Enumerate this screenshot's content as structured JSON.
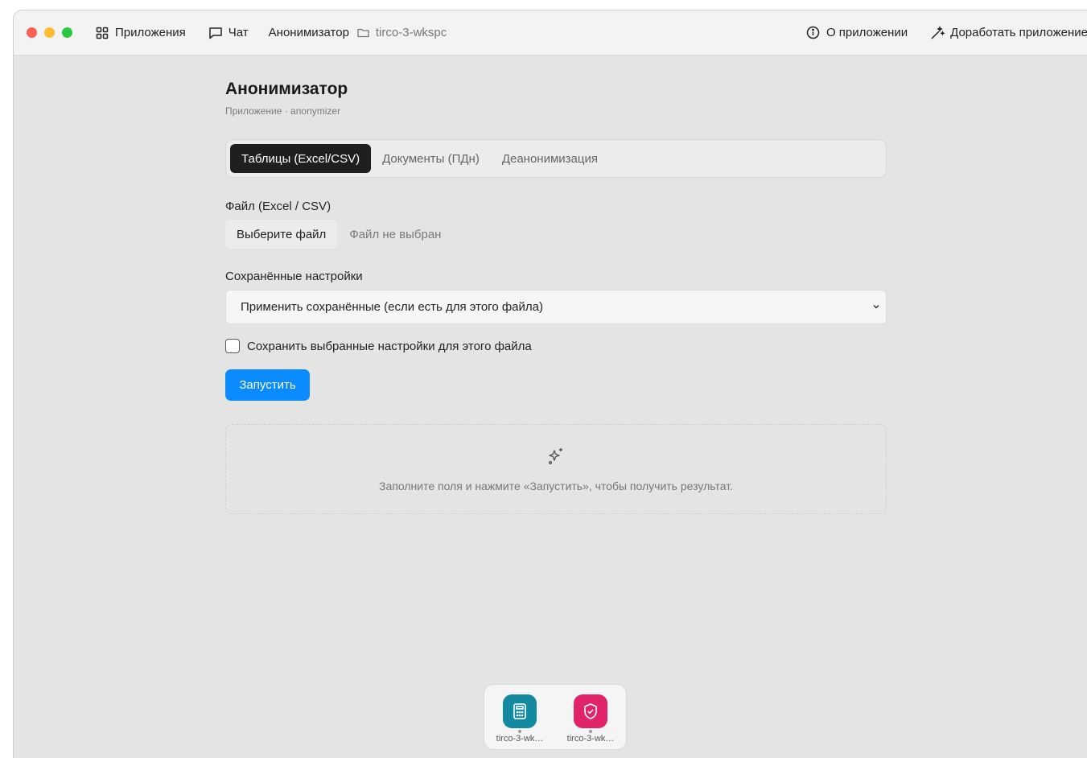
{
  "titlebar": {
    "apps_label": "Приложения",
    "chat_label": "Чат",
    "current_app": "Анонимизатор",
    "workspace": "tirco-3-wkspc",
    "about_label": "О приложении",
    "improve_label": "Доработать приложение"
  },
  "page": {
    "title": "Анонимизатор",
    "subtitle": "Приложение · anonymizer"
  },
  "tabs": [
    {
      "label": "Таблицы (Excel/CSV)",
      "active": true
    },
    {
      "label": "Документы (ПДн)",
      "active": false
    },
    {
      "label": "Деанонимизация",
      "active": false
    }
  ],
  "form": {
    "file_label": "Файл (Excel / CSV)",
    "file_button": "Выберите файл",
    "file_status": "Файл не выбран",
    "saved_label": "Сохранённые настройки",
    "saved_select_value": "Применить сохранённые (если есть для этого файла)",
    "save_checkbox_label": "Сохранить выбранные настройки для этого файла",
    "save_checkbox_checked": false,
    "run_button": "Запустить"
  },
  "result": {
    "placeholder": "Заполните поля и нажмите «Запустить», чтобы получить результат.",
    "icon": "sparkles-icon"
  },
  "dock": {
    "items": [
      {
        "label": "tirco-3-wk…",
        "icon": "calculator-icon",
        "color": "#138aa0"
      },
      {
        "label": "tirco-3-wk…",
        "icon": "shield-check-icon",
        "color": "#e1246a"
      }
    ]
  },
  "colors": {
    "accent": "#0a8cff",
    "active_tab": "#1f1f1f"
  }
}
